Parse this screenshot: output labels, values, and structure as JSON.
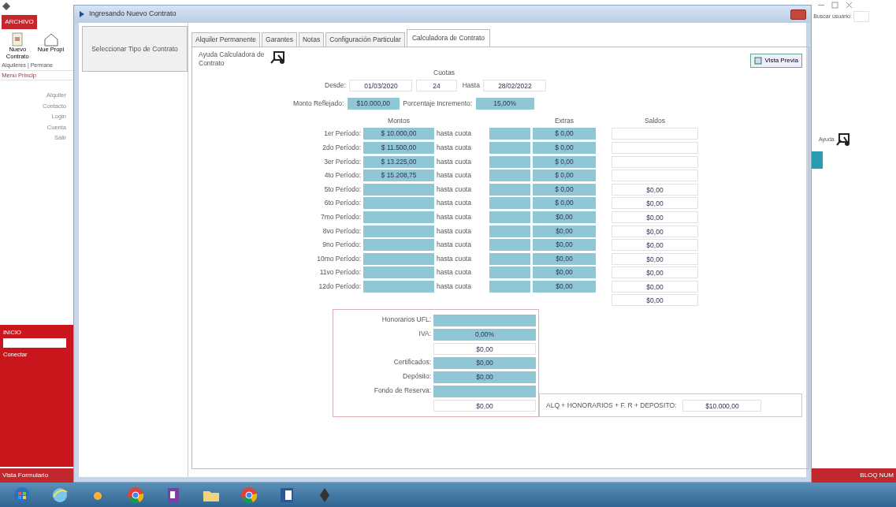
{
  "background_app": {
    "file_tab": "ARCHIVO",
    "ribbon_buttons": [
      {
        "label": "Nuevo Contrato"
      },
      {
        "label": "Nue Propi"
      }
    ],
    "breadcrumb": "Alquileres | Permane",
    "nav_item": "Menú Princip",
    "side_links": [
      "Alquiler",
      "Contacto",
      "Login",
      "Cuenta",
      "Salir"
    ],
    "login_panel": {
      "title": "INICIO",
      "button": "Conectar"
    },
    "status_left": "Vista Formulario",
    "search_label": "Buscar usuario:",
    "help_label": "Ayuda",
    "status_right": "BLOQ NUM"
  },
  "window": {
    "title": "Ingresando Nuevo Contrato"
  },
  "type_button": "Seleccionar Tipo de Contrato",
  "tabs": [
    {
      "label": "Alquiler Permanente",
      "selected": false
    },
    {
      "label": "Garantes",
      "selected": false
    },
    {
      "label": "Notas",
      "selected": false
    },
    {
      "label": "Configuración Particular",
      "selected": false
    },
    {
      "label": "Calculadora de Contrato",
      "selected": true
    }
  ],
  "calculator": {
    "help_title": "Ayuda Calculadora de Contrato",
    "preview_button": "Vista Previa",
    "installments_label": "Cuotas",
    "from_label": "Desde:",
    "from_date": "01/03/2020",
    "installments": "24",
    "to_label": "Hasta",
    "to_date": "28/02/2022",
    "amount_label": "Monto Reflejado:",
    "amount": "$10.000,00",
    "percent_label": "Porcentaje Incremento:",
    "percent": "15,00%",
    "headers": {
      "amounts": "Montos",
      "extras": "Extras",
      "balances": "Saldos"
    },
    "periods": [
      {
        "label": "1er Período:",
        "amount": "$ 10.000,00",
        "until": "hasta cuota",
        "extra": "$ 0,00"
      },
      {
        "label": "2do Período:",
        "amount": "$ 11.500,00",
        "until": "hasta cuota",
        "extra": "$ 0,00"
      },
      {
        "label": "3er Período:",
        "amount": "$ 13.225,00",
        "until": "hasta cuota",
        "extra": "$ 0,00"
      },
      {
        "label": "4to Período:",
        "amount": "$ 15.208,75",
        "until": "hasta cuota",
        "extra": "$ 0,00"
      },
      {
        "label": "5to Período:",
        "until": "hasta cuota",
        "extra": "$ 0,00",
        "balance": "$0,00"
      },
      {
        "label": "6to Período:",
        "until": "hasta cuota",
        "extra": "$ 0,00",
        "balance": "$0,00"
      },
      {
        "label": "7mo Período:",
        "until": "hasta cuota",
        "extra": "$0,00",
        "balance": "$0,00"
      },
      {
        "label": "8vo Período:",
        "until": "hasta cuota",
        "extra": "$0,00",
        "balance": "$0,00"
      },
      {
        "label": "9no Período:",
        "until": "hasta cuota",
        "extra": "$0,00",
        "balance": "$0,00"
      },
      {
        "label": "10mo Período:",
        "until": "hasta cuota",
        "extra": "$0,00",
        "balance": "$0,00"
      },
      {
        "label": "11vo Período:",
        "until": "hasta cuota",
        "extra": "$0,00",
        "balance": "$0,00"
      },
      {
        "label": "12do Período:",
        "until": "hasta cuota",
        "extra": "$0,00",
        "balance": "$0,00"
      }
    ],
    "balance_total": "$0,00",
    "fees": [
      {
        "label": "Honorarios UFL:",
        "kind": "filled"
      },
      {
        "label": "IVA:",
        "kind": "filled",
        "value": "0,00%"
      },
      {
        "kind": "plain",
        "value": "$0,00"
      },
      {
        "label": "Certificados:",
        "kind": "filled",
        "value": "$0,00"
      },
      {
        "label": "Depósito:",
        "kind": "filled",
        "value": "$0,00"
      },
      {
        "label": "Fondo de Reserva:",
        "kind": "filled"
      },
      {
        "kind": "plain",
        "value": "$0,00"
      }
    ],
    "formula_label": "ALQ + HONORARIOS + F. R + DEPOSITO:",
    "formula_total": "$10.000,00"
  }
}
